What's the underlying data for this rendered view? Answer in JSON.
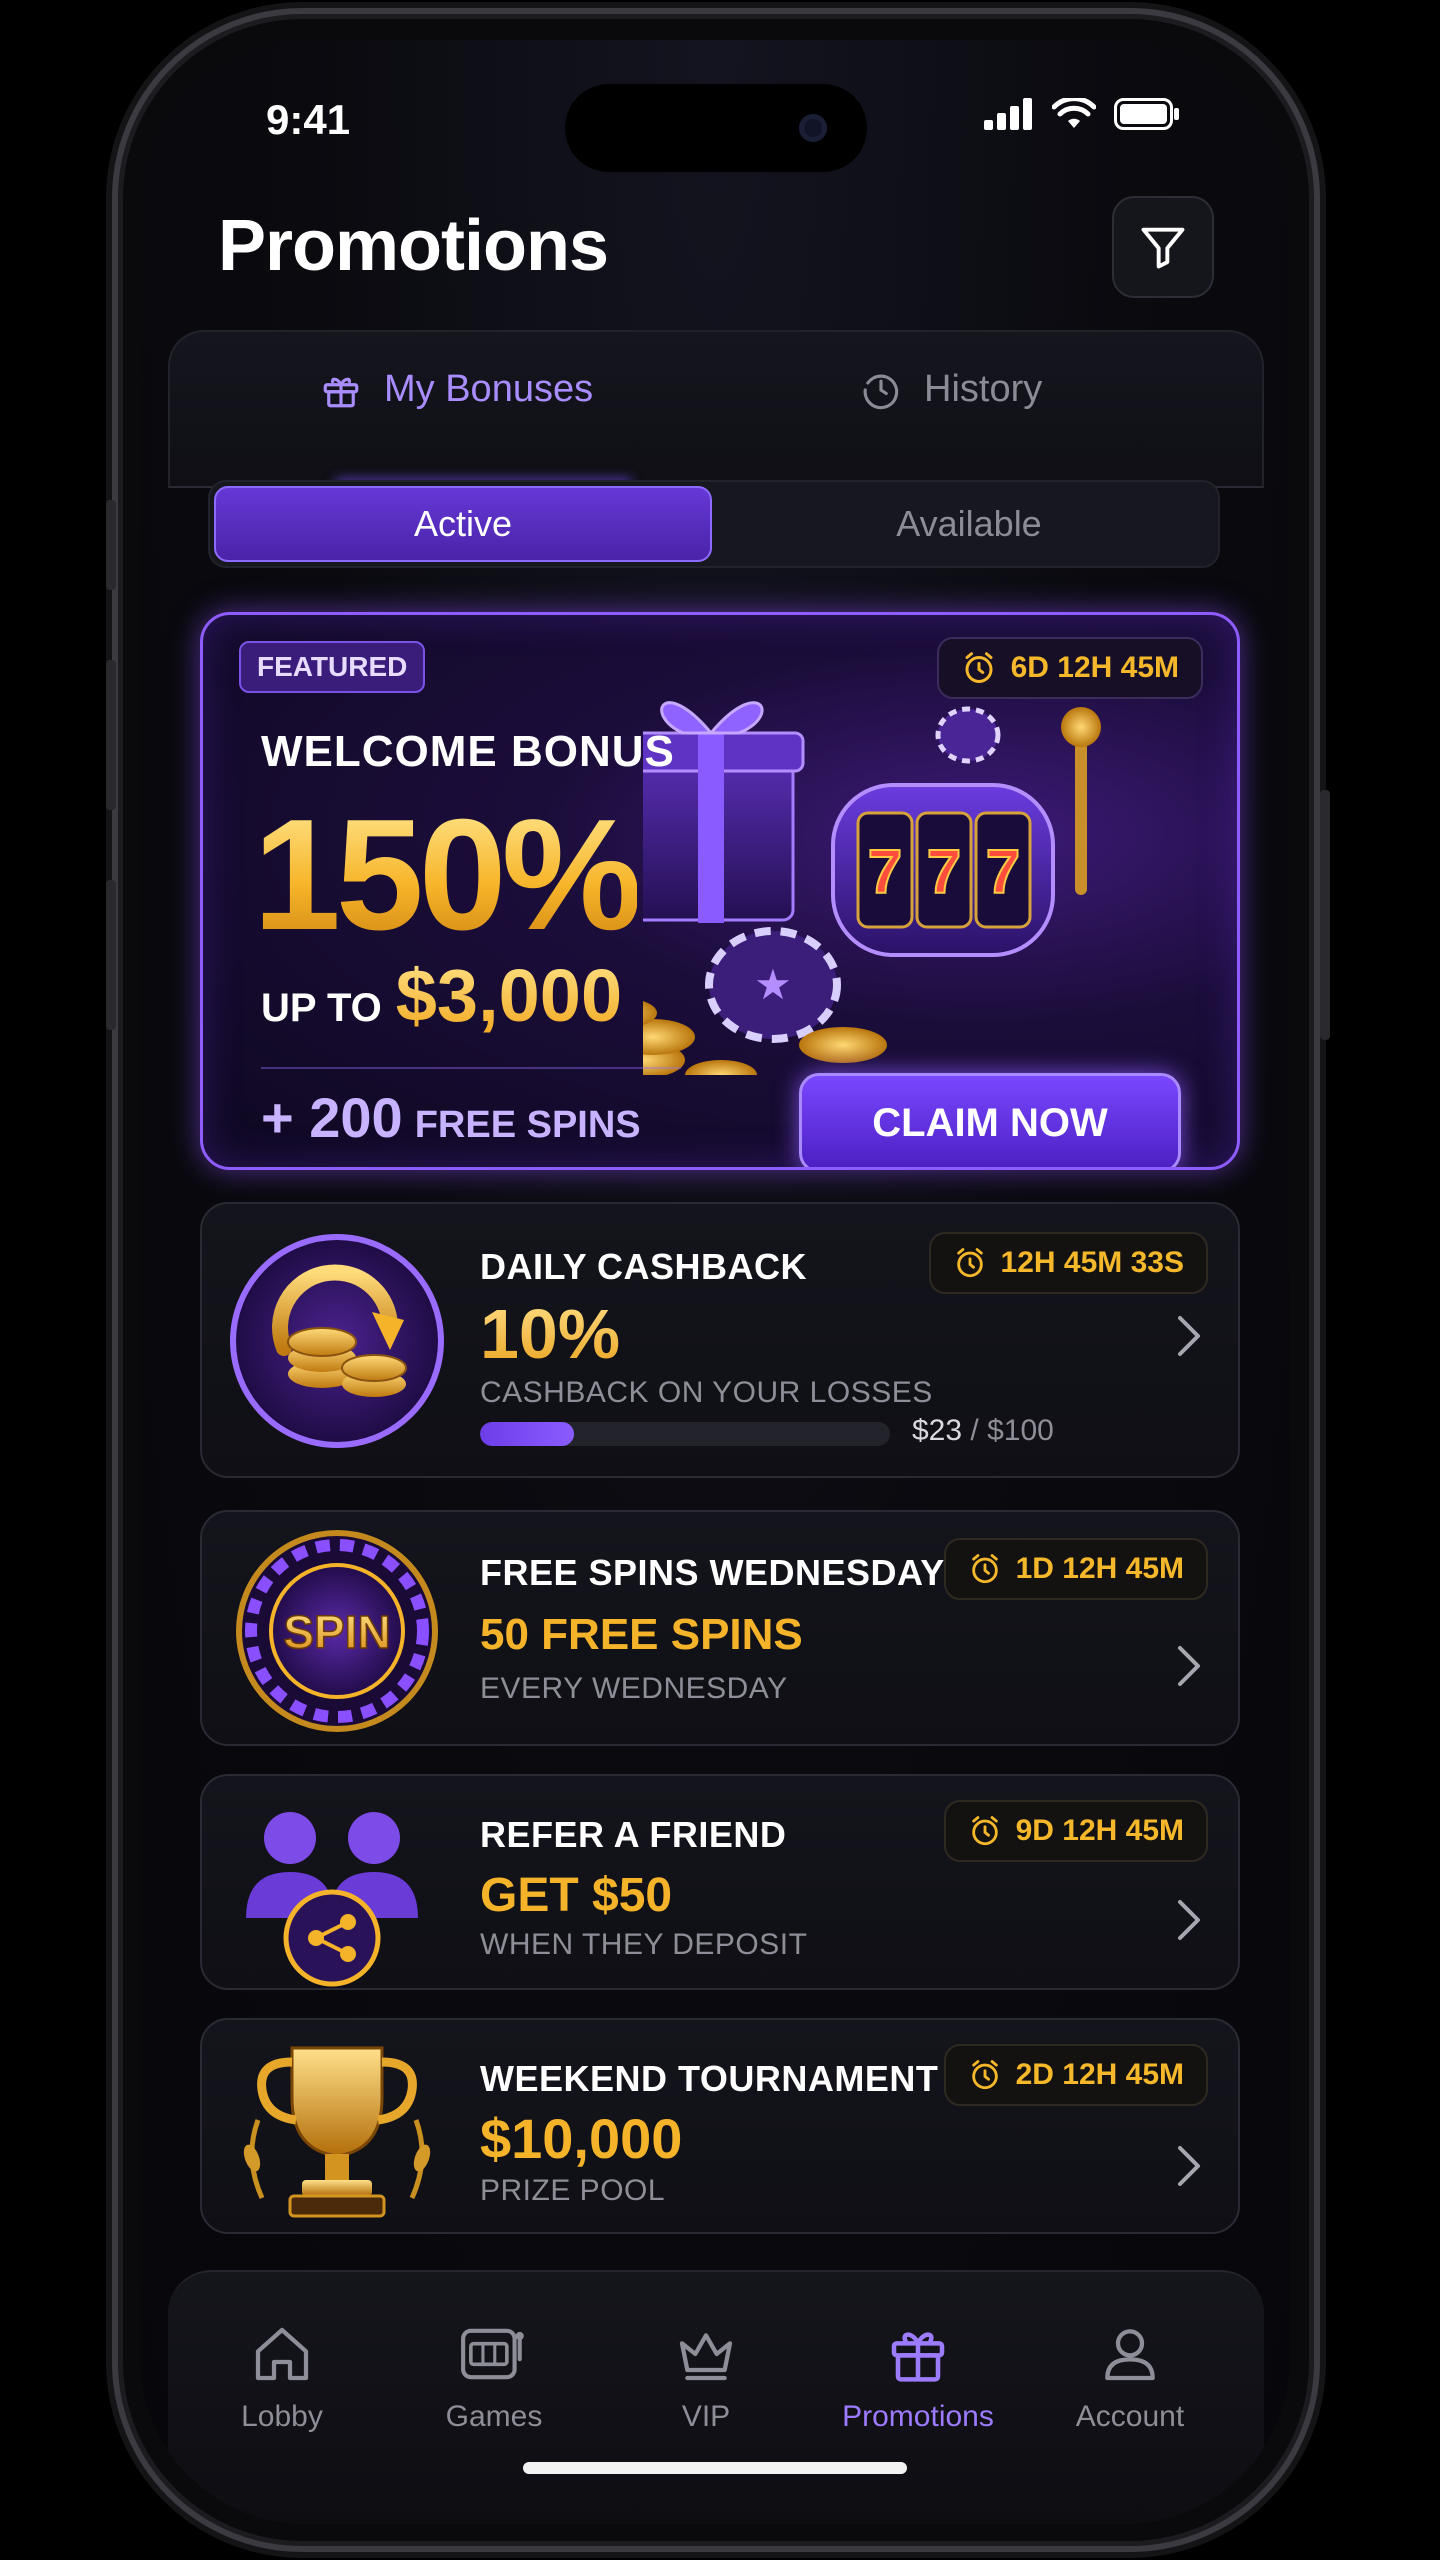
{
  "status_bar": {
    "time": "9:41"
  },
  "header": {
    "title": "Promotions",
    "filter_icon": "filter-icon"
  },
  "tabs": [
    {
      "label": "My Bonuses",
      "icon": "gift-icon",
      "active": true
    },
    {
      "label": "History",
      "icon": "clock-icon",
      "active": false
    }
  ],
  "segments": {
    "active": "Active",
    "inactive": "Available"
  },
  "featured": {
    "badge": "FEATURED",
    "timer": "6D 12H 45M",
    "title": "WELCOME BONUS",
    "percent": "150%",
    "up_to_label": "UP TO",
    "up_to_amount": "$3,000",
    "spins_count": "+ 200",
    "spins_label": "FREE SPINS",
    "cta": "CLAIM NOW",
    "slot_reels": "777"
  },
  "promos": [
    {
      "name": "DAILY CASHBACK",
      "value": "10%",
      "sub": "CASHBACK ON YOUR LOSSES",
      "timer": "12H 45M 33S",
      "icon": "cashback-coins-icon",
      "progress": {
        "current": "$23",
        "separator": " / ",
        "max": "$100",
        "fraction": 0.23
      }
    },
    {
      "name": "FREE SPINS WEDNESDAY",
      "value": "50 FREE SPINS",
      "sub": "EVERY WEDNESDAY",
      "timer": "1D 12H 45M",
      "icon": "spin-wheel-icon",
      "icon_text": "SPIN"
    },
    {
      "name": "REFER A FRIEND",
      "value": "GET $50",
      "sub": "WHEN THEY DEPOSIT",
      "timer": "9D 12H 45M",
      "icon": "refer-friends-icon"
    },
    {
      "name": "WEEKEND TOURNAMENT",
      "value": "$10,000",
      "sub": "PRIZE POOL",
      "timer": "2D 12H 45M",
      "icon": "trophy-icon"
    }
  ],
  "bottom_nav": [
    {
      "label": "Lobby",
      "icon": "home-icon",
      "active": false
    },
    {
      "label": "Games",
      "icon": "slot-machine-icon",
      "active": false
    },
    {
      "label": "VIP",
      "icon": "crown-icon",
      "active": false
    },
    {
      "label": "Promotions",
      "icon": "gift-icon",
      "active": true
    },
    {
      "label": "Account",
      "icon": "user-icon",
      "active": false
    }
  ],
  "colors": {
    "accent": "#8c67ff",
    "gold": "#f5b32a",
    "background": "#0a0a0f"
  }
}
